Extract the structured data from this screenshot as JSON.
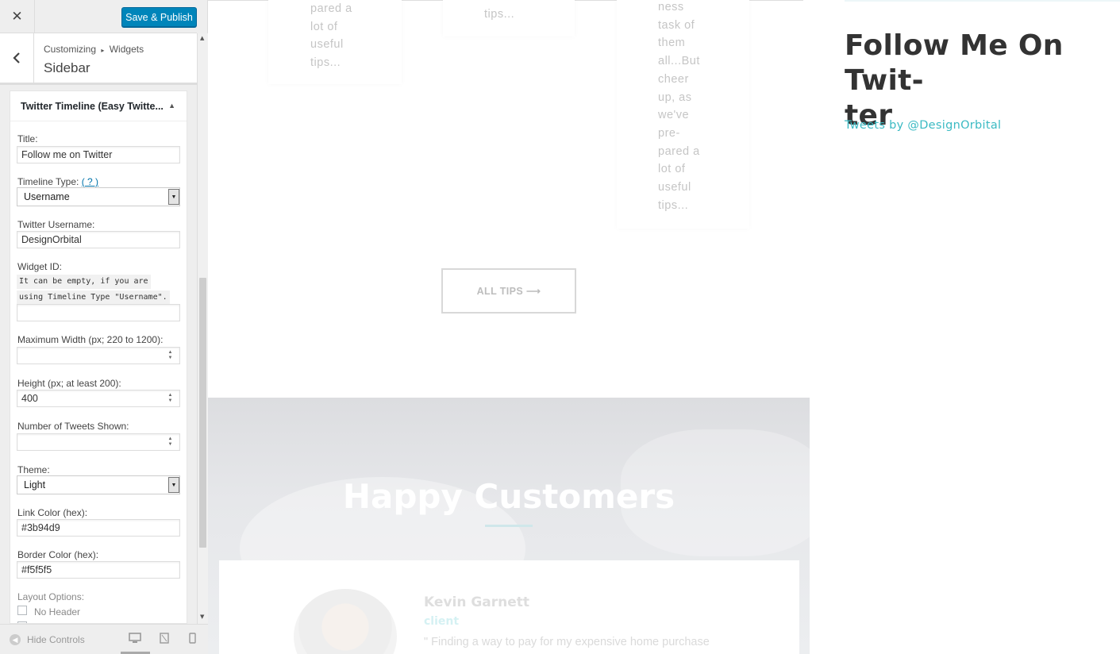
{
  "customizer": {
    "close_glyph": "✕",
    "save_label": "Save & Publish",
    "breadcrumb_root": "Customizing",
    "breadcrumb_sep": "▸",
    "breadcrumb_leaf": "Widgets",
    "section_title": "Sidebar",
    "widget_title": "Twitter Timeline (Easy Twitte...",
    "fields": {
      "title_label": "Title:",
      "title_value": "Follow me on Twitter",
      "timeline_type_label": "Timeline Type:",
      "timeline_help": "( ? )",
      "timeline_type_value": "Username",
      "username_label": "Twitter Username:",
      "username_value": "DesignOrbital",
      "widget_id_label": "Widget ID:",
      "widget_id_note_1": "It can be empty, if you are",
      "widget_id_note_2": "using Timeline Type \"Username\".",
      "widget_id_value": "",
      "max_width_label": "Maximum Width (px; 220 to 1200):",
      "max_width_value": "",
      "height_label": "Height (px; at least 200):",
      "height_value": "400",
      "tweets_shown_label": "Number of Tweets Shown:",
      "tweets_shown_value": "",
      "theme_label": "Theme:",
      "theme_value": "Light",
      "link_color_label": "Link Color (hex):",
      "link_color_value": "#3b94d9",
      "border_color_label": "Border Color (hex):",
      "border_color_value": "#f5f5f5",
      "layout_label": "Layout Options:",
      "no_header_label": "No Header"
    },
    "footer": {
      "hide_controls": "Hide Controls",
      "devices": [
        "desktop-icon",
        "tablet-icon",
        "mobile-icon"
      ],
      "active_device": "desktop"
    }
  },
  "preview": {
    "tip_cards": [
      {
        "lines": [
          "pared a",
          "lot of",
          "useful",
          "tips..."
        ]
      },
      {
        "lines": [
          "tips..."
        ]
      },
      {
        "lines": [
          "ness",
          "task of",
          "them",
          "all...But",
          "cheer",
          "up, as",
          "we've",
          "pre-",
          "pared a",
          "lot of",
          "useful",
          "tips..."
        ]
      }
    ],
    "all_tips_label": "ALL TIPS ⟶",
    "customers_title": "Happy Customers",
    "testimonial": {
      "name": "Kevin Garnett",
      "role": "client",
      "quote": "\" Finding a way to pay for my expensive home purchase"
    },
    "sidebar": {
      "title_line1": "Follow Me On Twit-",
      "title_line2": "ter",
      "tweets_link": "Tweets by @DesignOrbital"
    }
  },
  "colors": {
    "accent": "#0085ba",
    "link": "#3bbac3"
  }
}
